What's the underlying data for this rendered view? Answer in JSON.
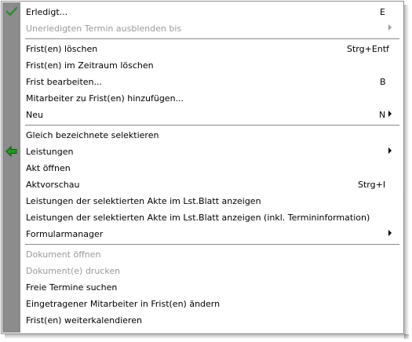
{
  "menu": {
    "groups": [
      [
        {
          "label": "Erledigt...",
          "shortcut": "E",
          "icon": "check-icon"
        },
        {
          "label": "Unerledigten Termin ausblenden bis",
          "submenu": true,
          "disabled": true
        }
      ],
      [
        {
          "label": "Frist(en) löschen",
          "shortcut": "Strg+Entf"
        },
        {
          "label": "Frist(en) im Zeitraum löschen"
        },
        {
          "label": "Frist bearbeiten...",
          "shortcut": "B"
        },
        {
          "label": "Mitarbeiter zu Frist(en) hinzufügen..."
        },
        {
          "label": "Neu",
          "shortcut": "N",
          "submenu": true
        }
      ],
      [
        {
          "label": "Gleich bezeichnete selektieren"
        },
        {
          "label": "Leistungen",
          "submenu": true,
          "icon": "green-arrow-left-icon"
        },
        {
          "label": "Akt öffnen"
        },
        {
          "label": "Aktvorschau",
          "shortcut": "Strg+I"
        },
        {
          "label": "Leistungen der selektierten Akte im Lst.Blatt anzeigen"
        },
        {
          "label": "Leistungen der selektierten Akte im Lst.Blatt anzeigen (inkl. Termininformation)"
        },
        {
          "label": "Formularmanager",
          "submenu": true
        }
      ],
      [
        {
          "label": "Dokument öffnen",
          "disabled": true
        },
        {
          "label": "Dokument(e) drucken",
          "disabled": true
        },
        {
          "label": "Freie Termine suchen"
        },
        {
          "label": "Eingetragener Mitarbeiter in Frist(en) ändern"
        },
        {
          "label": "Frist(en) weiterkalendieren"
        }
      ]
    ]
  },
  "colors": {
    "gutter": "#8c8c8c",
    "disabled_text": "#9a9a9a",
    "check_icon": "#2e8b2e",
    "arrow_icon": "#1f9a1f"
  }
}
